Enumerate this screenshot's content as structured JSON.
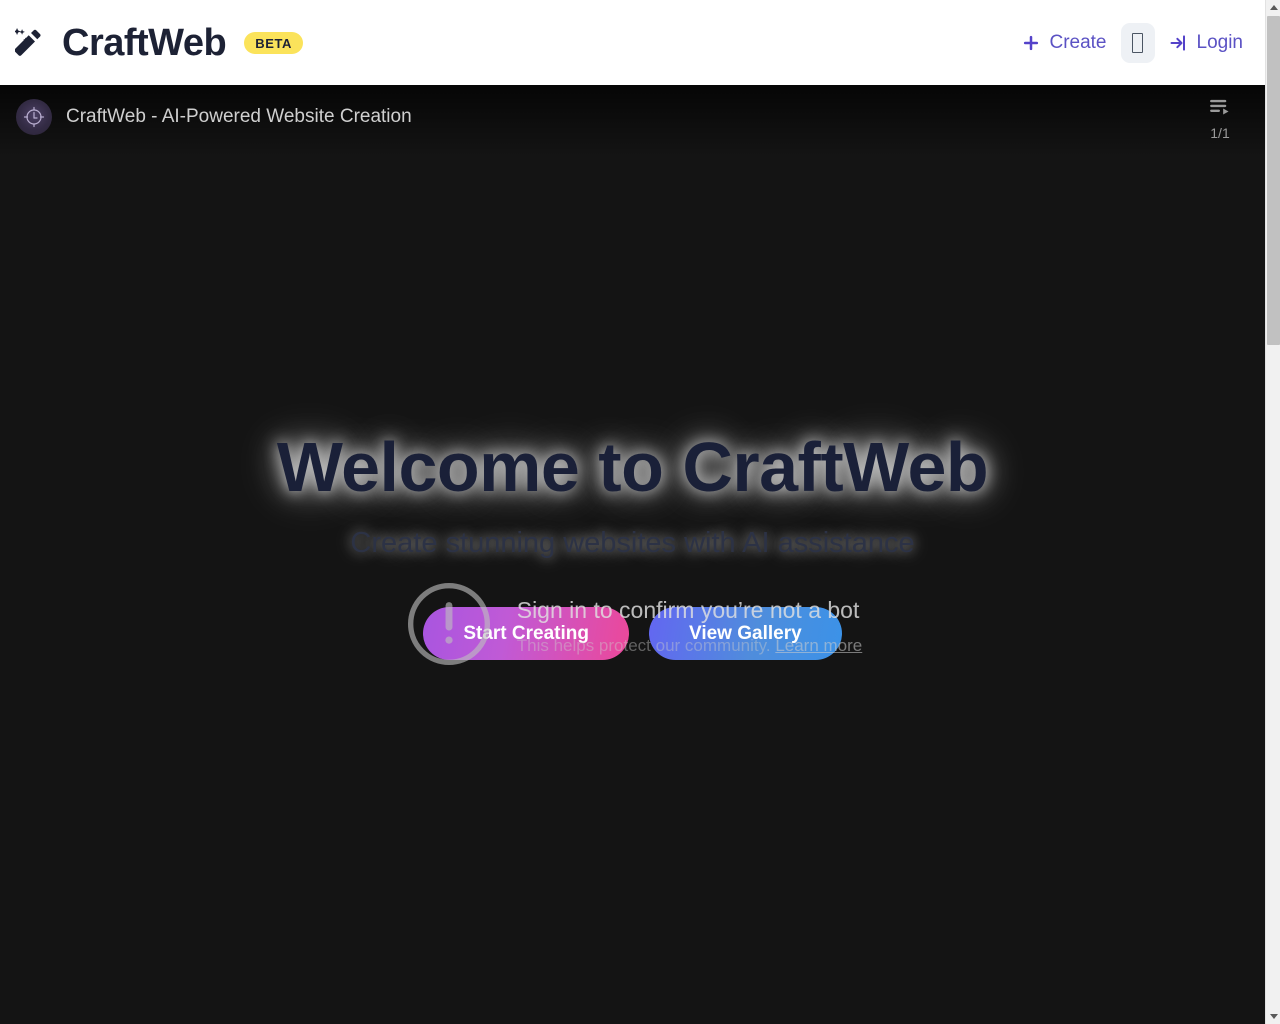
{
  "header": {
    "brand_name": "CraftWeb",
    "brand_icon": "magic-wand-icon",
    "beta_label": "BETA",
    "create_label": "Create",
    "login_label": "Login",
    "theme_button_glyph": "missing-glyph-box",
    "accent_color": "#5b52c4",
    "beta_badge_color": "#fbe35b",
    "brand_text_color": "#1d2235"
  },
  "player": {
    "title": "CraftWeb - AI-Powered Website Creation",
    "avatar": "channel-avatar-icon",
    "playlist_icon": "playlist-icon",
    "playlist_count": "1/1",
    "background_color": "#141414"
  },
  "hero": {
    "title": "Welcome to CraftWeb",
    "subtitle": "Create stunning websites with AI assistance",
    "primary_button": "Start Creating",
    "secondary_button": "View Gallery",
    "primary_gradient_from": "#a855e0",
    "primary_gradient_to": "#ec4899",
    "secondary_gradient_from": "#6366f1",
    "secondary_gradient_to": "#3b92e8"
  },
  "bot_check": {
    "icon": "alert-circle-icon",
    "title": "Sign in to confirm you’re not a bot",
    "subtitle_text": "This helps protect our community.",
    "link_label": "Learn more"
  },
  "scrollbar": {
    "up_arrow": "scroll-up-arrow-icon",
    "down_arrow": "scroll-down-arrow-icon",
    "thumb": "scrollbar-thumb"
  }
}
